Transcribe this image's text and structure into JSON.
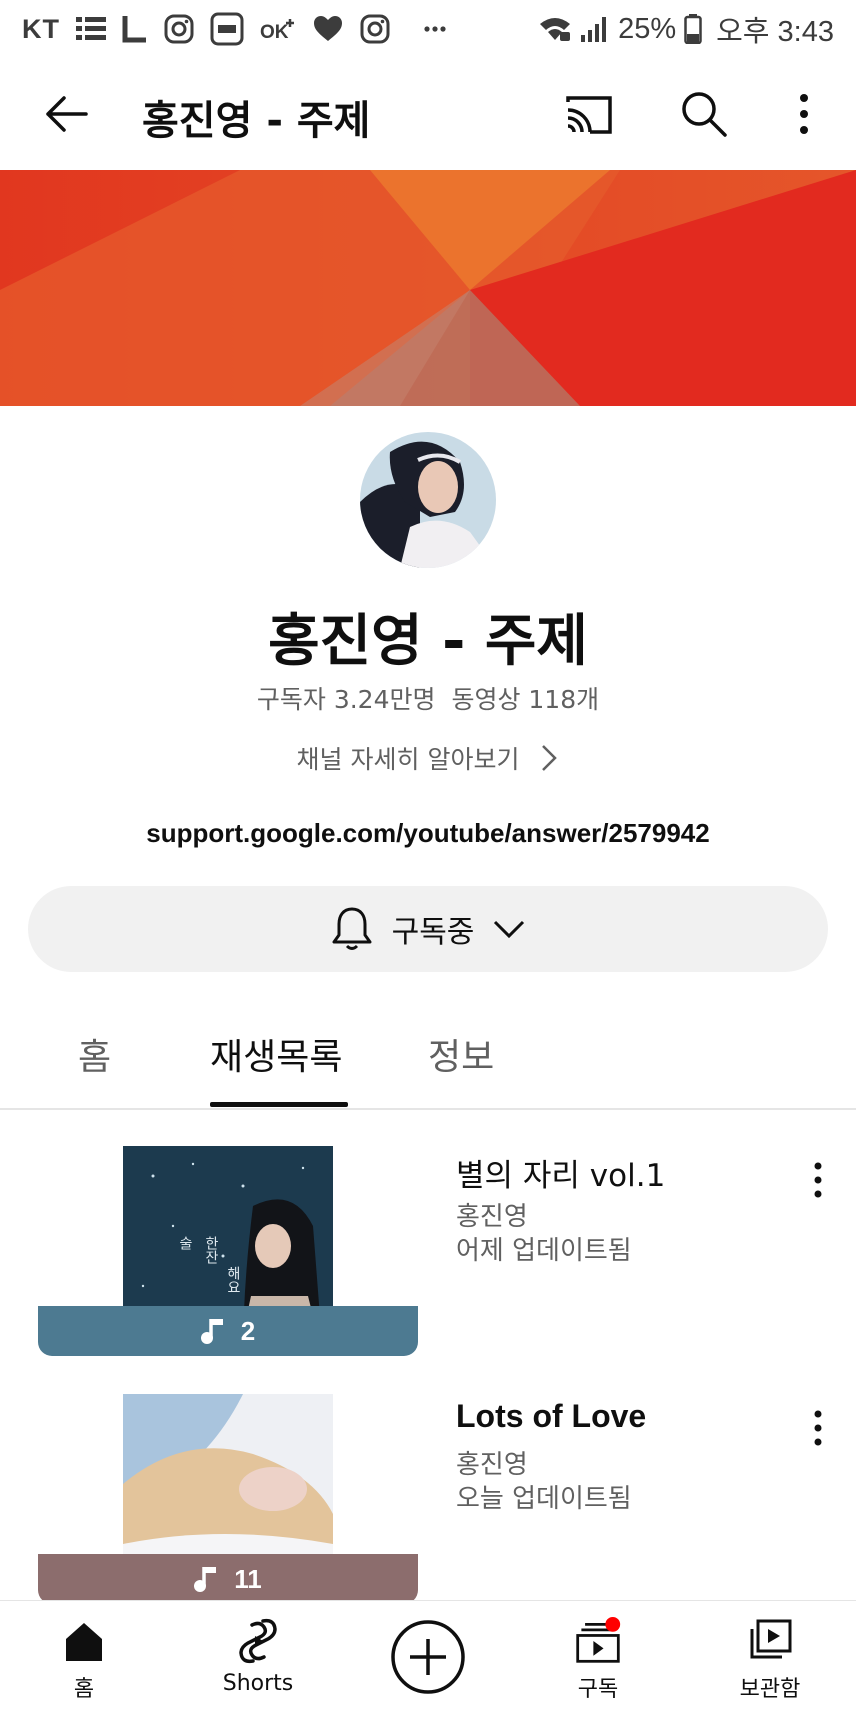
{
  "status_bar": {
    "carrier": "KT",
    "battery": "25%",
    "time": "오후 3:43",
    "notification_icons": [
      "list-icon",
      "l-app-icon",
      "instagram-icon",
      "homeshopping-icon",
      "ok-cashbag-icon",
      "heart-icon",
      "instagram-icon",
      "more-dots-icon"
    ]
  },
  "app_bar": {
    "title": "홍진영 - 주제"
  },
  "channel": {
    "name": "홍진영 - 주제",
    "subscribers": "구독자 3.24만명",
    "videos": "동영상 118개",
    "more_label": "채널 자세히 알아보기",
    "link": "support.google.com/youtube/answer/2579942",
    "subscribe_label": "구독중"
  },
  "tabs": [
    {
      "label": "홈",
      "active": false
    },
    {
      "label": "재생목록",
      "active": true
    },
    {
      "label": "정보",
      "active": false
    }
  ],
  "playlists": [
    {
      "title": "별의 자리 vol.1",
      "author": "홍진영",
      "updated": "어제 업데이트됨",
      "count": "2",
      "overlay_color": "#4d7a91"
    },
    {
      "title": "Lots of Love",
      "author": "홍진영",
      "updated": "오늘 업데이트됨",
      "count": "11",
      "overlay_color": "#8c6d6d"
    }
  ],
  "bottom_nav": [
    {
      "label": "홈",
      "icon": "home-icon"
    },
    {
      "label": "Shorts",
      "icon": "shorts-icon"
    },
    {
      "label": "",
      "icon": "create-icon"
    },
    {
      "label": "구독",
      "icon": "subscriptions-icon"
    },
    {
      "label": "보관함",
      "icon": "library-icon"
    }
  ],
  "colors": {
    "banner_red": "#e03b24",
    "banner_orange": "#e8602a",
    "text_primary": "#0f0f0f",
    "text_secondary": "#606060",
    "notification_dot": "#ff0000"
  }
}
